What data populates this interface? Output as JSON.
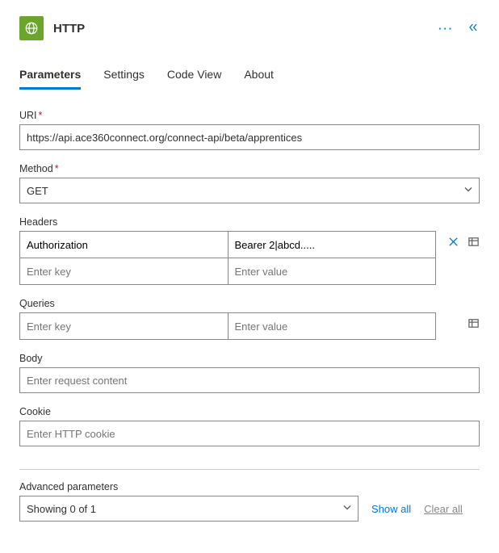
{
  "header": {
    "title": "HTTP"
  },
  "tabs": {
    "parameters": "Parameters",
    "settings": "Settings",
    "codeview": "Code View",
    "about": "About"
  },
  "labels": {
    "uri": "URI",
    "method": "Method",
    "headers": "Headers",
    "queries": "Queries",
    "body": "Body",
    "cookie": "Cookie",
    "advanced": "Advanced parameters"
  },
  "uri": {
    "value": "https://api.ace360connect.org/connect-api/beta/apprentices"
  },
  "method": {
    "value": "GET"
  },
  "headers": {
    "rows": [
      {
        "key": "Authorization",
        "value": "Bearer 2|abcd....."
      }
    ],
    "placeholder_key": "Enter key",
    "placeholder_value": "Enter value"
  },
  "queries": {
    "placeholder_key": "Enter key",
    "placeholder_value": "Enter value"
  },
  "body": {
    "placeholder": "Enter request content"
  },
  "cookie": {
    "placeholder": "Enter HTTP cookie"
  },
  "advanced": {
    "selected": "Showing 0 of 1",
    "showall": "Show all",
    "clearall": "Clear all"
  }
}
